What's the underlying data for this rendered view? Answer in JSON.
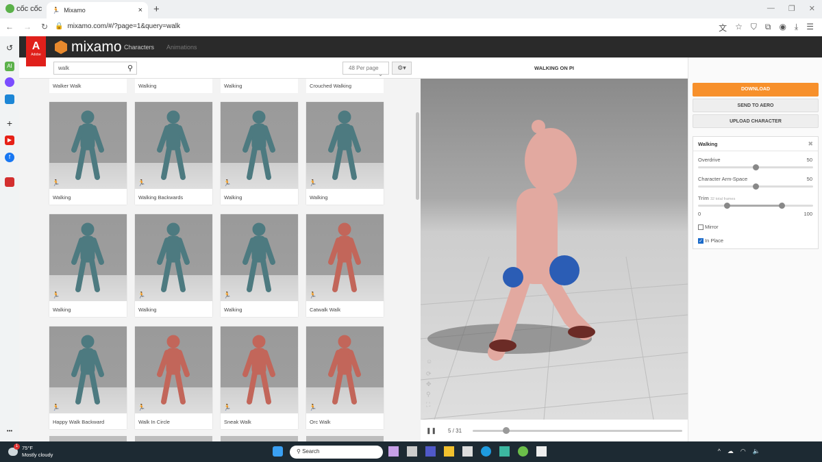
{
  "browser": {
    "brand": "cốc cốc",
    "tab_title": "Mixamo",
    "url": "mixamo.com/#/?page=1&query=walk"
  },
  "mixamo": {
    "logo": "mixamo",
    "adobe": "Adobe",
    "nav": [
      "Characters",
      "Animations"
    ]
  },
  "toolbar": {
    "search_value": "walk",
    "per_page": "48 Per page"
  },
  "grid": {
    "top_partial": [
      "Walker Walk",
      "Walking",
      "Walking",
      "Crouched Walking"
    ],
    "cards": [
      {
        "label": "Walking",
        "color": "#4d7a80"
      },
      {
        "label": "Walking Backwards",
        "color": "#4d7a80"
      },
      {
        "label": "Walking",
        "color": "#4d7a80"
      },
      {
        "label": "Walking",
        "color": "#4d7a80"
      },
      {
        "label": "Walking",
        "color": "#4d7a80"
      },
      {
        "label": "Walking",
        "color": "#4d7a80"
      },
      {
        "label": "Walking",
        "color": "#4d7a80"
      },
      {
        "label": "Catwalk Walk",
        "color": "#c2665a"
      },
      {
        "label": "Happy Walk Backward",
        "color": "#4d7a80"
      },
      {
        "label": "Walk In Circle",
        "color": "#c2665a"
      },
      {
        "label": "Sneak Walk",
        "color": "#c2665a"
      },
      {
        "label": "Orc Walk",
        "color": "#c2665a"
      }
    ]
  },
  "viewer": {
    "title": "WALKING ON PI",
    "frame": "5 / 31",
    "progress": 0.16
  },
  "panel": {
    "download": "DOWNLOAD",
    "send": "SEND TO AERO",
    "upload": "UPLOAD CHARACTER",
    "settings_title": "Walking",
    "overdrive_label": "Overdrive",
    "overdrive": "50",
    "armspace_label": "Character Arm-Space",
    "armspace": "50",
    "trim_label": "Trim",
    "trim_note": "32 total frames",
    "trim_min": "0",
    "trim_max": "100",
    "trim_range": [
      25,
      75
    ],
    "mirror": "Mirror",
    "mirror_checked": false,
    "inplace": "In Place",
    "inplace_checked": true
  },
  "taskbar": {
    "temp": "75°F",
    "weather": "Mostly cloudy",
    "search": "Search",
    "badge": "1"
  }
}
